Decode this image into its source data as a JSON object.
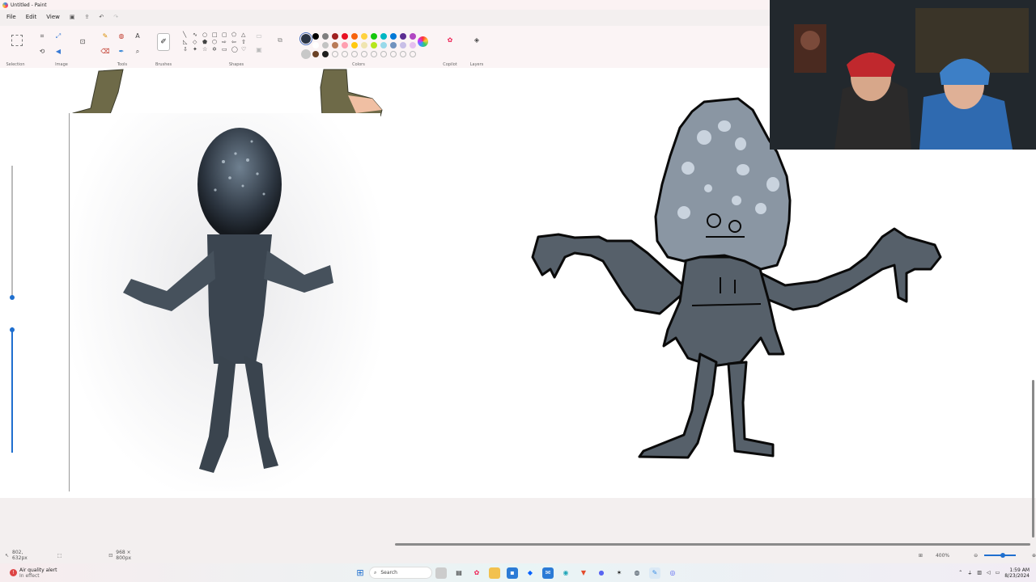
{
  "window": {
    "title": "Untitled - Paint"
  },
  "menu": {
    "file": "File",
    "edit": "Edit",
    "view": "View"
  },
  "ribbon": {
    "groups": {
      "selection": "Selection",
      "image": "Image",
      "tools": "Tools",
      "brushes": "Brushes",
      "shapes": "Shapes",
      "colors": "Colors",
      "copilot": "Copilot",
      "layers": "Layers"
    },
    "colors": {
      "primary": "#2b3444",
      "secondary": "#c8c8c8",
      "row1": [
        "#000000",
        "#7f7f7f",
        "#a02020",
        "#e81123",
        "#f7630c",
        "#ffd23f",
        "#16c60c",
        "#00b7c3",
        "#0078d7",
        "#5c2d91",
        "#b146c2"
      ],
      "row2": [
        "#ffffff",
        "#c3c3c3",
        "#b97a57",
        "#ff9fb0",
        "#ffc90e",
        "#efe4b0",
        "#b5e61d",
        "#99d9ea",
        "#7092be",
        "#c8bfe7",
        "#e6c0f0"
      ],
      "row3": [
        "#6b4226",
        "#1e1e1e",
        "",
        "",
        "",
        "",
        "",
        "",
        "",
        "",
        ""
      ]
    }
  },
  "statusbar": {
    "cursor_pos": "802, 632px",
    "canvas_size": "968 × 800px",
    "zoom": "400%"
  },
  "taskbar": {
    "search_label": "Search",
    "notification_title": "Air quality alert",
    "notification_sub": "In effect",
    "time": "1:59 AM",
    "date": "8/23/2024"
  }
}
